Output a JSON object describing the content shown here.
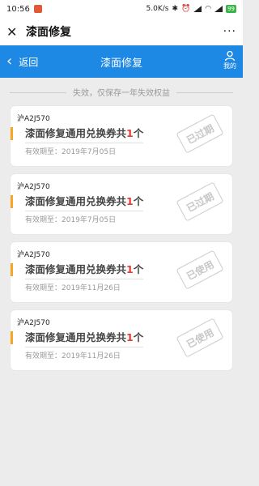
{
  "status_bar": {
    "time": "10:56",
    "net_speed": "5.0K/s",
    "battery": "99"
  },
  "app_bar": {
    "title": "漆面修复",
    "more": "···"
  },
  "header": {
    "back_label": "返回",
    "title": "漆面修复",
    "mine_label": "我的",
    "color": "#1e88e5"
  },
  "notice": "失效，仅保存一年失效权益",
  "cards": [
    {
      "plate": "沪A2J570",
      "coupon_prefix": "漆面修复通用兑换券共",
      "count": "1",
      "unit": "个",
      "expiry": "有效期至：2019年7月05日",
      "status": "已过期"
    },
    {
      "plate": "沪A2J570",
      "coupon_prefix": "漆面修复通用兑换券共",
      "count": "1",
      "unit": "个",
      "expiry": "有效期至：2019年7月05日",
      "status": "已过期"
    },
    {
      "plate": "沪A2J570",
      "coupon_prefix": "漆面修复通用兑换券共",
      "count": "1",
      "unit": "个",
      "expiry": "有效期至：2019年11月26日",
      "status": "已使用"
    },
    {
      "plate": "沪A2J570",
      "coupon_prefix": "漆面修复通用兑换券共",
      "count": "1",
      "unit": "个",
      "expiry": "有效期至：2019年11月26日",
      "status": "已使用"
    }
  ]
}
